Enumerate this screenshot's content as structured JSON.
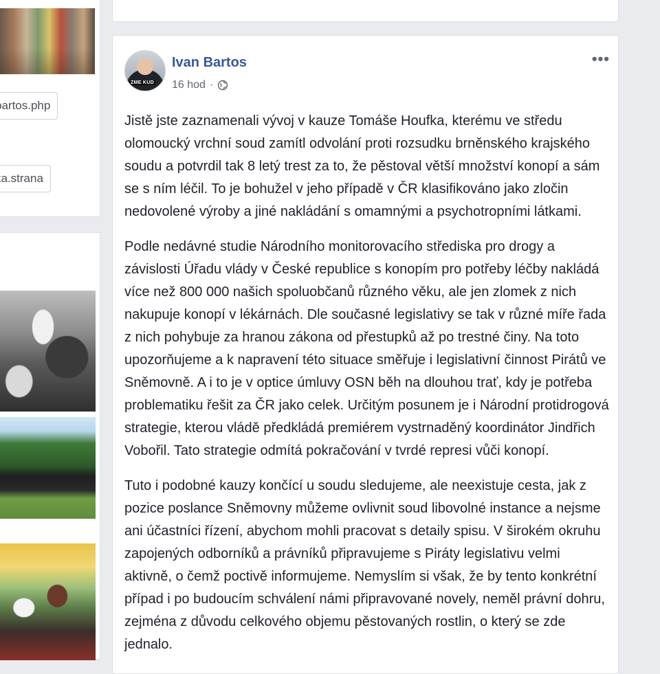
{
  "left": {
    "links": [
      "bartos.php",
      "ka.strana"
    ]
  },
  "post": {
    "author": "Ivan Bartos",
    "time": "16 hod",
    "separator": "·",
    "avatar_tag": "ZME KUD",
    "more_label": "•••",
    "paragraphs": [
      "Jistě jste zaznamenali vývoj v kauze Tomáše Houfka, kterému ve středu olomoucký vrchní soud zamítl odvolání proti rozsudku brněnského krajského soudu a potvrdil tak 8 letý trest za to, že pěstoval větší množství konopí a sám se s ním léčil. To je bohužel v jeho případě v ČR klasifikováno jako zločin nedovolené výroby a jiné nakládání s omamnými a psychotropními látkami.",
      "Podle nedávné studie Národního monitorovacího střediska pro drogy a závislosti Úřadu vlády v České republice s konopím pro potřeby léčby nakládá více než 800 000 našich spoluobčanů různého věku, ale jen zlomek z nich nakupuje konopí v lékárnách. Dle současné legislativy se tak v různé míře řada z nich pohybuje za hranou zákona od přestupků až po trestné činy. Na toto upozorňujeme a k napravení této situace směřuje i legislativní činnost Pirátů ve Sněmovně. A i to je v optice úmluvy OSN běh na dlouhou trať, kdy je potřeba problematiku řešit za ČR jako celek. Určitým posunem je i Národní protidrogová strategie, kterou vládě předkládá premiérem vystrnaděný koordinátor Jindřich Vobořil. Tato strategie odmítá pokračování v tvrdé represi vůči konopí.",
      "Tuto i podobné kauzy končící u soudu sledujeme, ale neexistuje cesta, jak z pozice poslance Sněmovny můžeme ovlivnit soud libovolné instance a nejsme ani účastníci řízení, abychom mohli pracovat s detaily spisu. V širokém okruhu zapojených odborníků a právníků připravujeme s Piráty legislativu velmi aktivně, o čemž poctivě informujeme. Nemyslím si však, že by tento konkrétní případ i po budoucím schválení námi připravované novely, neměl právní dohru, zejména z důvodu celkového objemu pěstovaných rostlin, o který se zde jednalo."
    ]
  },
  "colors": {
    "page_bg": "#e9ebee",
    "author_link": "#385898",
    "meta_text": "#616770",
    "body_text": "#1d2129"
  },
  "icons": {
    "privacy": "globe-icon",
    "options": "more-options-icon"
  }
}
